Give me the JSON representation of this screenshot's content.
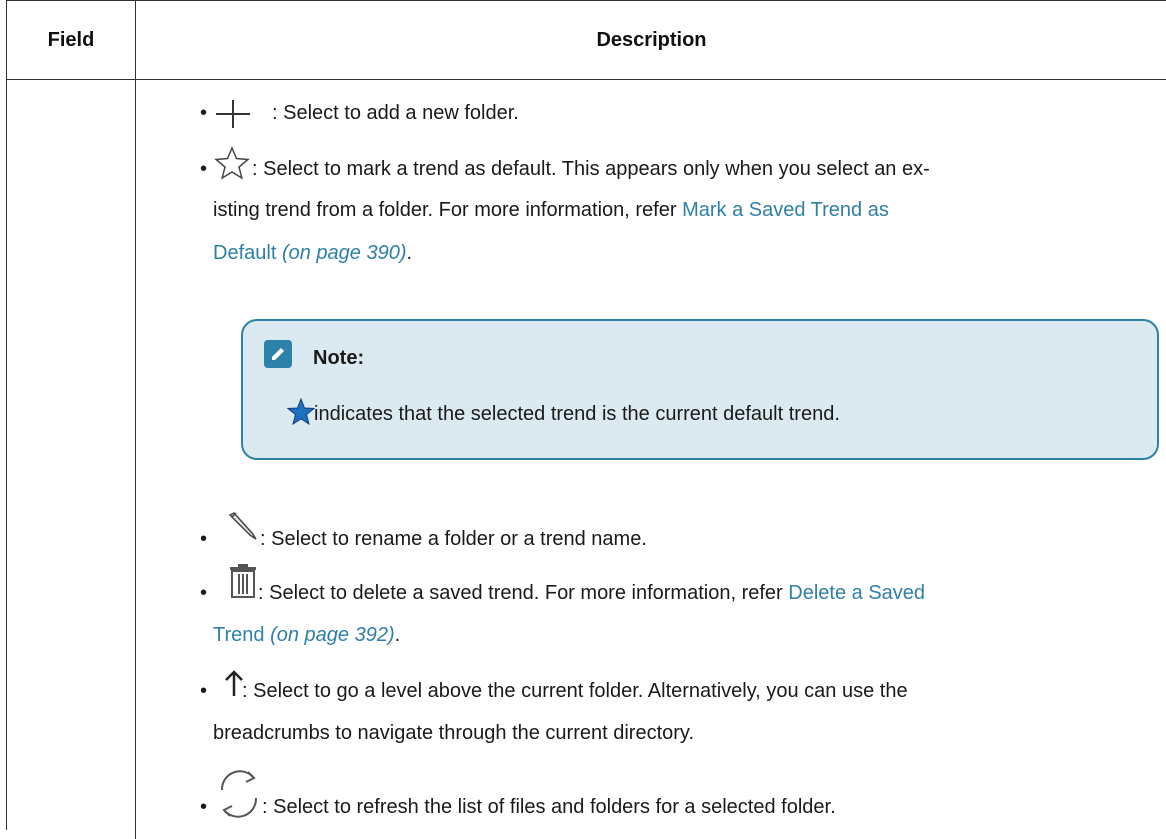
{
  "table": {
    "headers": {
      "field": "Field",
      "description": "Description"
    }
  },
  "items": {
    "add": {
      "text": ": Select to add a new folder.",
      "icon": "plus-icon"
    },
    "default": {
      "line1": ": Select to mark a trend as default. This appears only when you select an ex-",
      "line2a": "isting trend from a folder. For more information, refer ",
      "link": "Mark a Saved Trend as",
      "line3_link": "Default",
      "pageref": "(on page 390)",
      "tail": ".",
      "icon": "star-outline-icon"
    },
    "note": {
      "title": "Note:",
      "text": " indicates that the selected trend is the current default trend.",
      "icon": "star-filled-icon"
    },
    "rename": {
      "text": ": Select to rename a folder or a trend name.",
      "icon": "pencil-icon"
    },
    "delete": {
      "line1": ": Select to delete a saved trend. For more information, refer ",
      "link1": "Delete a Saved",
      "link2": "Trend",
      "pageref": "(on page 392)",
      "tail": ".",
      "icon": "trash-icon"
    },
    "up": {
      "line1": ": Select to go a level above the current folder. Alternatively, you can use the",
      "line2": "breadcrumbs to navigate through the current directory.",
      "icon": "arrow-up-icon"
    },
    "refresh": {
      "text": ": Select to refresh the list of files and folders for a selected folder.",
      "icon": "refresh-icon"
    }
  },
  "colors": {
    "link": "#2f7fa8",
    "note_border": "#2c82a8",
    "note_bg": "#dbe9f0"
  }
}
